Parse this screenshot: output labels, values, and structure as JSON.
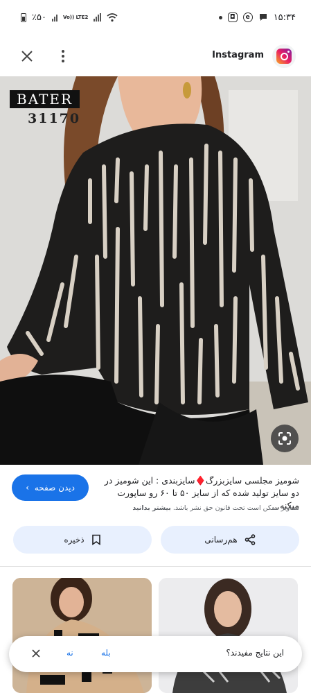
{
  "status_bar": {
    "battery": "٪۵۰",
    "network": "Vo)) LTE2",
    "time": "۱۵:۳۴"
  },
  "topbar": {
    "source_name": "Instagram",
    "icons": [
      "close-icon",
      "more-vert-icon",
      "instagram-logo"
    ]
  },
  "image": {
    "brand": "BATER",
    "code": "31170"
  },
  "caption": {
    "visit_label": "دیدن صفحه",
    "text": "شومیز مجلسی سایزبزرگ♦️سایزبندی : این شومیز در دو سایز تولید شده که از سایز ۵۰ تا ۶۰ رو ساپورت میکنه...",
    "copyright": "تصاویر ممکن است تحت قانون حق نشر باشد.",
    "learn_more": "بیشتر بدانید"
  },
  "actions": {
    "share_label": "هم‌رسانی",
    "save_label": "ذخیره"
  },
  "feedback": {
    "question": "این نتایج مفیدند؟",
    "yes": "بله",
    "no": "نه"
  },
  "colors": {
    "accent": "#1a73e8",
    "chip_bg": "#e8f0fe"
  }
}
